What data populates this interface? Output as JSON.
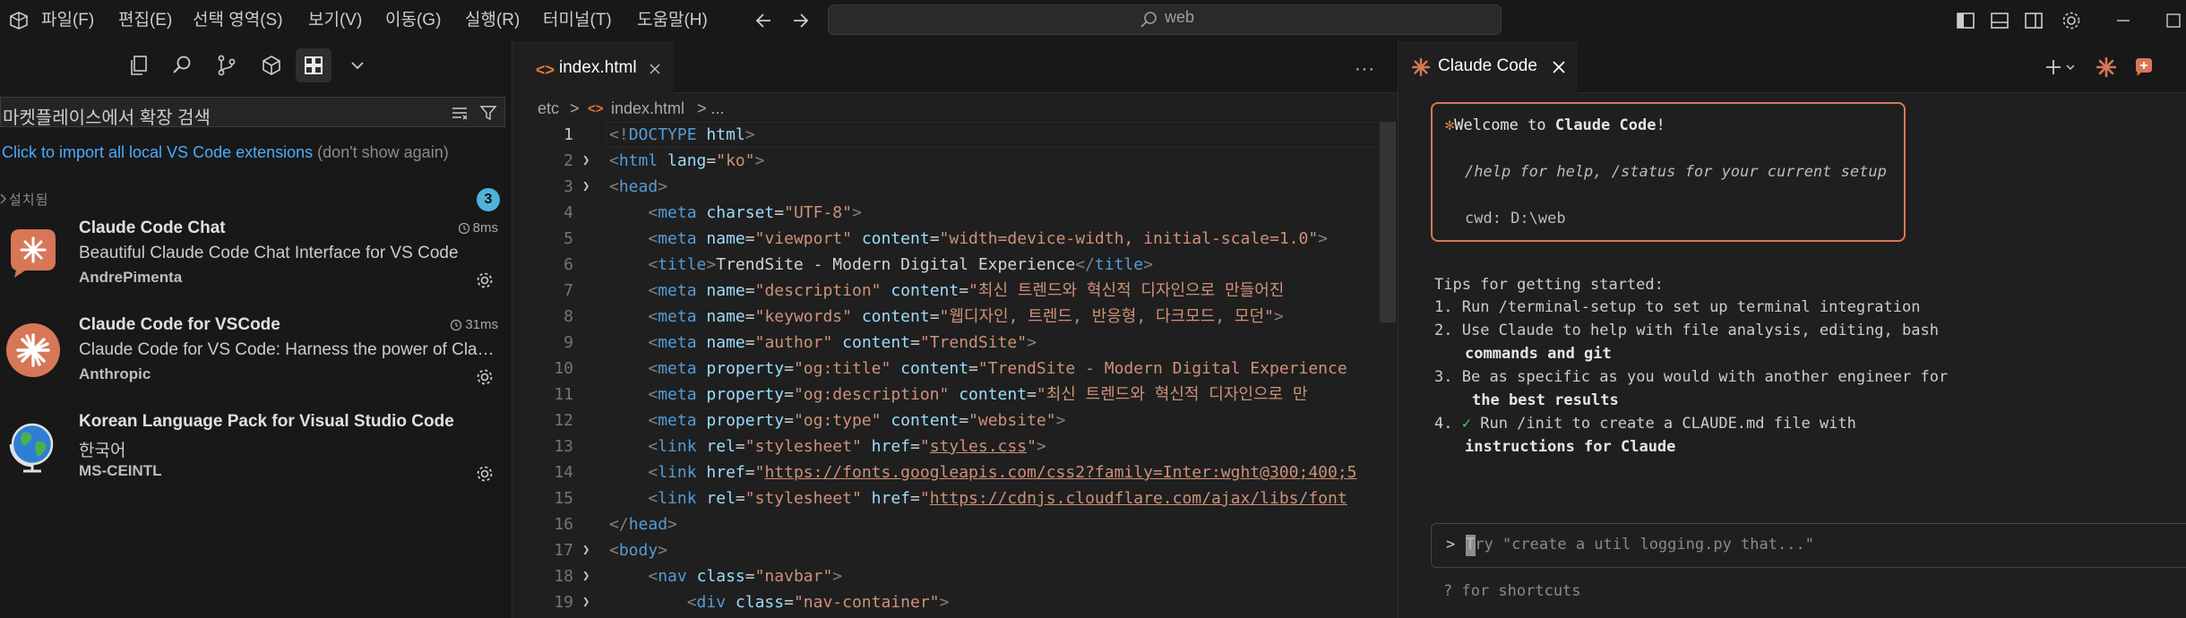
{
  "titlebar": {
    "menu": [
      "파일(F)",
      "편집(E)",
      "선택 영역(S)",
      "보기(V)",
      "이동(G)",
      "실행(R)",
      "터미널(T)",
      "도움말(H)"
    ],
    "command_center_text": "web",
    "icons": [
      "back-icon",
      "forward-icon",
      "search-icon",
      "toggle-primary-sidebar-icon",
      "toggle-panel-icon",
      "toggle-secondary-sidebar-icon",
      "customize-layout-icon",
      "minimize-icon",
      "maximize-icon"
    ]
  },
  "sidebar": {
    "toolbar_icons": [
      "explorer-icon",
      "search-icon",
      "source-control-icon",
      "run-debug-icon",
      "extensions-icon",
      "chevron-down-icon"
    ],
    "search_value": "마켓플레이스에서 확장 검색",
    "import_link": "Click to import all local VS Code extensions",
    "dont_show": "(don't show again)",
    "installed_label": "설치됨",
    "installed_count": "3",
    "extensions": [
      {
        "name": "Claude Code Chat",
        "description": "Beautiful Claude Code Chat Interface for VS Code",
        "publisher": "AndrePimenta",
        "time": "8ms"
      },
      {
        "name": "Claude Code for VSCode",
        "description": "Claude Code for VS Code: Harness the power of Claude Code without leaving your IDE",
        "publisher": "Anthropic",
        "time": "31ms"
      },
      {
        "name": "Korean Language Pack for Visual Studio Code",
        "description": "한국어",
        "publisher": "MS-CEINTL",
        "time": ""
      }
    ]
  },
  "editor": {
    "tab_label": "index.html",
    "tab_icon": "<>",
    "more": "···",
    "breadcrumb": {
      "folder": "etc",
      "sep": ">",
      "file": "index.html",
      "tail": "> ..."
    },
    "line_numbers": [
      "1",
      "2",
      "3",
      "4",
      "5",
      "6",
      "7",
      "8",
      "9",
      "10",
      "11",
      "12",
      "13",
      "14",
      "15",
      "16",
      "17",
      "18",
      "19"
    ]
  },
  "claude": {
    "tab_label": "Claude Code",
    "welcome_prefix": "Welcome to ",
    "welcome_name": "Claude Code",
    "welcome_suffix": "!",
    "welcome_asterisk": "✻",
    "help_line": "/help for help, /status for your current setup",
    "cwd_line": "cwd: D:\\web",
    "tips_title": "Tips for getting started:",
    "tips": [
      {
        "num": "1.",
        "text": "Run /terminal-setup to set up terminal integration",
        "cont": ""
      },
      {
        "num": "2.",
        "text": "Use Claude to help with file analysis, editing, bash",
        "cont": "commands and git"
      },
      {
        "num": "3.",
        "text": "Be as specific as you would with another engineer for",
        "cont": "the best results"
      },
      {
        "num": "4.",
        "text": "Run /init to create a CLAUDE.md file with",
        "cont": "instructions for Claude",
        "check": "✓"
      }
    ],
    "prompt_caret": ">",
    "prompt_placeholder": "Try \"create a util logging.py that...\"",
    "shortcuts_hint": "? for shortcuts"
  },
  "colors": {
    "accent_orange": "#d77757",
    "link_blue": "#4daafc",
    "badge_blue": "#4fb2d8",
    "html_tag": "#569cd6",
    "html_attr": "#9cdcfe",
    "html_string": "#ce9178"
  }
}
